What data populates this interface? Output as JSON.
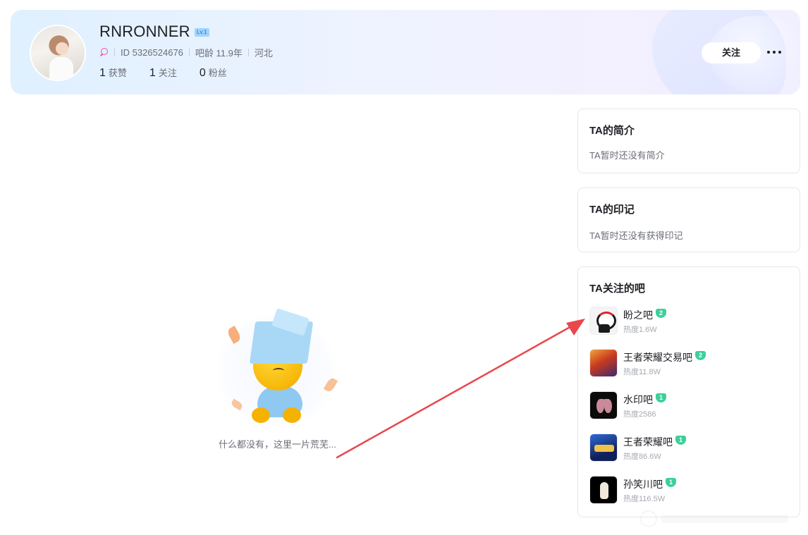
{
  "profile": {
    "username": "RNRONNER",
    "level_badge": "Lv.1",
    "id_text": "ID 5326524676",
    "age_text": "吧龄 11.9年",
    "location": "河北",
    "stats": [
      {
        "num": "1",
        "label": "获赞"
      },
      {
        "num": "1",
        "label": "关注"
      },
      {
        "num": "0",
        "label": "粉丝"
      }
    ],
    "follow_label": "关注"
  },
  "intro_card": {
    "title": "TA的简介",
    "text": "TA暂时还没有简介"
  },
  "marks_card": {
    "title": "TA的印记",
    "text": "TA暂时还没有获得印记"
  },
  "bars_card": {
    "title": "TA关注的吧",
    "items": [
      {
        "name": "盼之吧",
        "level": "2",
        "heat": "热度1.6W",
        "icon": "panda-avatar"
      },
      {
        "name": "王者荣耀交易吧",
        "level": "2",
        "heat": "热度11.8W",
        "icon": "hero-avatar"
      },
      {
        "name": "水印吧",
        "level": "1",
        "heat": "热度2586",
        "icon": "butterfly-avatar"
      },
      {
        "name": "王者荣耀吧",
        "level": "1",
        "heat": "热度86.6W",
        "icon": "game-logo-avatar"
      },
      {
        "name": "孙笑川吧",
        "level": "1",
        "heat": "热度116.5W",
        "icon": "hand-avatar"
      }
    ]
  },
  "empty_state": {
    "text": "什么都没有，这里一片荒芜..."
  },
  "colors": {
    "accent_pink": "#f04f9e",
    "level_green": "#3ecf9a",
    "arrow_red": "#e8474c"
  }
}
